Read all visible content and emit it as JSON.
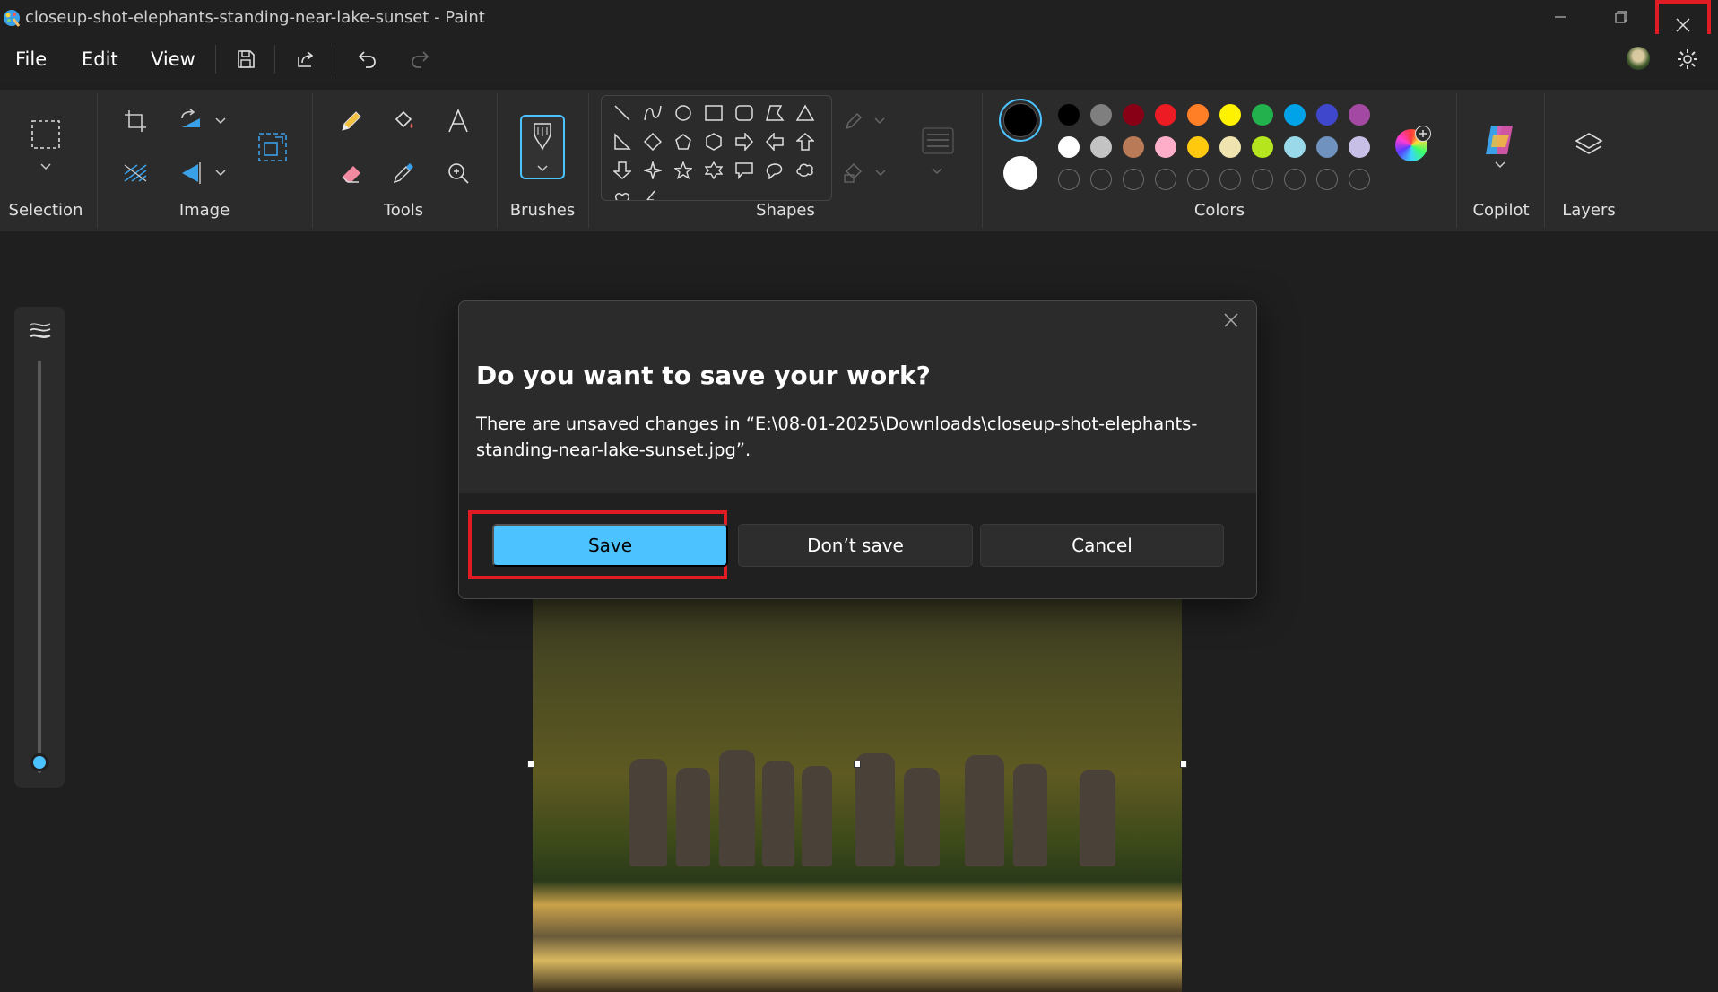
{
  "window": {
    "title": "closeup-shot-elephants-standing-near-lake-sunset - Paint",
    "controls": [
      "minimize-icon",
      "restore-icon",
      "close-icon"
    ]
  },
  "menu": {
    "file": "File",
    "edit": "Edit",
    "view": "View"
  },
  "quick_actions": [
    "save-icon",
    "share-icon",
    "undo-icon",
    "redo-icon"
  ],
  "ribbon": {
    "groups": {
      "selection": "Selection",
      "image": "Image",
      "tools": "Tools",
      "brushes": "Brushes",
      "shapes": "Shapes",
      "colors": "Colors",
      "copilot": "Copilot",
      "layers": "Layers"
    }
  },
  "colors": {
    "primary": "#000000",
    "secondary": "#ffffff",
    "row1": [
      "#000000",
      "#7f7f7f",
      "#880015",
      "#ed1c24",
      "#ff7f27",
      "#fff200",
      "#22b14c",
      "#00a2e8",
      "#3f48cc",
      "#a349a4"
    ],
    "row2": [
      "#ffffff",
      "#c3c3c3",
      "#b97a57",
      "#ffaec9",
      "#ffc90e",
      "#efe4b0",
      "#b5e61d",
      "#99d9ea",
      "#7092be",
      "#c8bfe7"
    ],
    "accent": "#4cc2ff",
    "highlight": "#e01b24"
  },
  "dialog": {
    "title": "Do you want to save your work?",
    "message": "There are unsaved changes in “E:\\08-01-2025\\Downloads\\closeup-shot-elephants-standing-near-lake-sunset.jpg”.",
    "save": "Save",
    "dont_save": "Don’t save",
    "cancel": "Cancel"
  }
}
